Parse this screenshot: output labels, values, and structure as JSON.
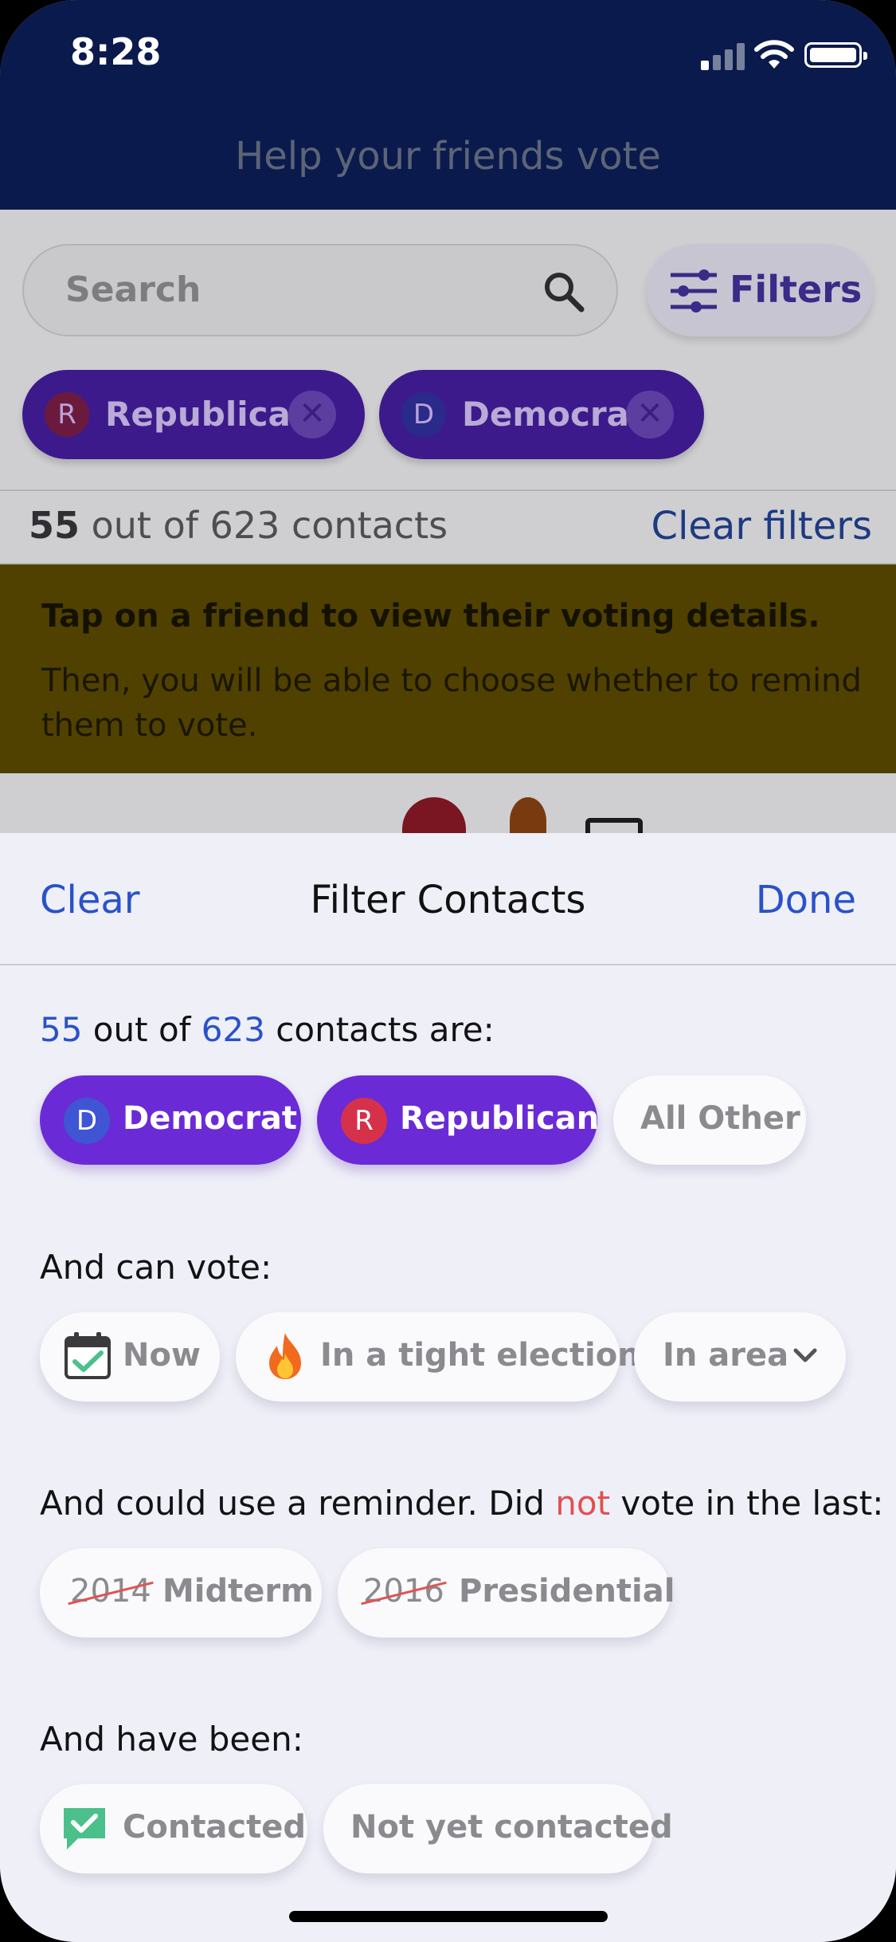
{
  "status_bar": {
    "time": "8:28"
  },
  "app": {
    "title": "Help your friends vote",
    "search_placeholder": "Search",
    "filters_label": "Filters",
    "active_chips": [
      {
        "badge": "R",
        "label": "Republican"
      },
      {
        "badge": "D",
        "label": "Democrat"
      }
    ],
    "count": {
      "shown": "55",
      "text": " out of 623 contacts"
    },
    "clear_filters": "Clear filters",
    "banner": {
      "title": "Tap on a friend to view their voting details.",
      "body": "Then, you will be able to choose whether to remind them to vote."
    }
  },
  "sheet": {
    "clear": "Clear",
    "title": "Filter Contacts",
    "done": "Done",
    "party_section": {
      "count_shown": "55",
      "mid": " out of ",
      "count_total": "623",
      "tail": " contacts are:",
      "chips": [
        {
          "badge": "D",
          "label": "Democrat",
          "selected": true
        },
        {
          "badge": "R",
          "label": "Republican",
          "selected": true
        },
        {
          "label": "All Other",
          "selected": false
        }
      ]
    },
    "vote_section": {
      "label": "And can vote:",
      "chips": [
        {
          "icon": "calendar-check-icon",
          "label": "Now"
        },
        {
          "icon": "fire-icon",
          "label": "In a tight election"
        },
        {
          "icon": "chevron-down-icon",
          "label": "In area"
        }
      ]
    },
    "reminder_section": {
      "pre": "And could use a reminder. Did ",
      "emph": "not",
      "post": " vote in the last:",
      "chips": [
        {
          "year": "2014",
          "label": "Midterm"
        },
        {
          "year": "2016",
          "label": "Presidential"
        }
      ]
    },
    "contacted_section": {
      "label": "And have been:",
      "chips": [
        {
          "icon": "chat-check-icon",
          "label": "Contacted"
        },
        {
          "label": "Not yet contacted"
        }
      ]
    }
  },
  "colors": {
    "accent": "#6a2bd6",
    "link": "#2a52c8",
    "democrat": "#3f55d4",
    "republican": "#d6314a",
    "navy": "#0a1a4c",
    "warn": "#e0514f"
  }
}
